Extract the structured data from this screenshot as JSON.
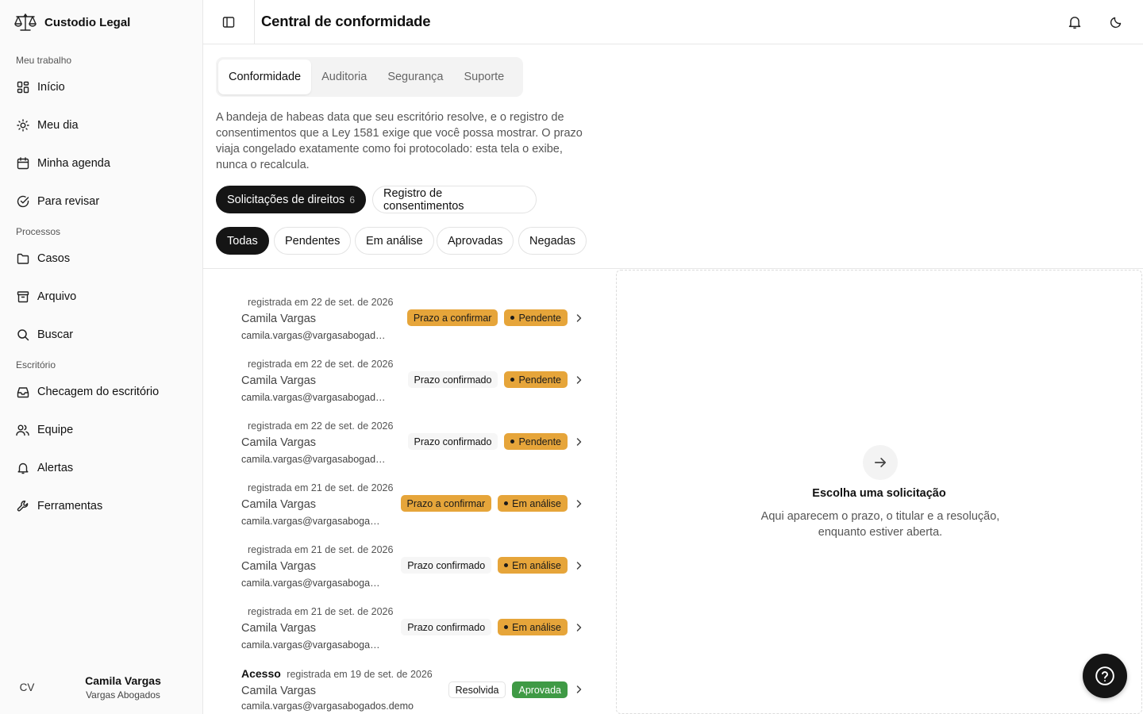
{
  "app": {
    "name": "Custodio Legal"
  },
  "sidebar": {
    "sections": [
      {
        "label": "Meu trabalho"
      },
      {
        "label": "Processos"
      },
      {
        "label": "Escritório"
      }
    ],
    "items": [
      {
        "label": "Início",
        "icon": "dashboard-icon"
      },
      {
        "label": "Meu dia",
        "icon": "sun-icon"
      },
      {
        "label": "Minha agenda",
        "icon": "calendar-icon"
      },
      {
        "label": "Para revisar",
        "icon": "check-circle-icon"
      },
      {
        "label": "Casos",
        "icon": "folder-icon"
      },
      {
        "label": "Arquivo",
        "icon": "archive-icon"
      },
      {
        "label": "Buscar",
        "icon": "search-icon"
      },
      {
        "label": "Checagem do escritório",
        "icon": "inbox-icon"
      },
      {
        "label": "Equipe",
        "icon": "users-icon"
      },
      {
        "label": "Alertas",
        "icon": "bell-icon"
      },
      {
        "label": "Ferramentas",
        "icon": "wrench-icon"
      }
    ],
    "user": {
      "initials": "CV",
      "name": "Camila Vargas",
      "org": "Vargas Abogados"
    }
  },
  "header": {
    "title": "Central de conformidade"
  },
  "tabs": [
    {
      "label": "Conformidade",
      "active": true
    },
    {
      "label": "Auditoria"
    },
    {
      "label": "Segurança"
    },
    {
      "label": "Suporte"
    }
  ],
  "intro": "A bandeja de habeas data que seu escritório resolve, e o registro de consentimentos que a Ley 1581 exige que você possa mostrar. O prazo viaja congelado exatamente como foi protocolado: esta tela o exibe, nunca o recalcula.",
  "view_toggle": {
    "requests_label": "Solicitações de direitos",
    "requests_count": "6",
    "consents_label": "Registro de consentimentos"
  },
  "filters": [
    "Todas",
    "Pendentes",
    "Em análise",
    "Aprovadas",
    "Negadas"
  ],
  "requests": [
    {
      "kind": "",
      "registered": "registrada em 22 de set. de 2026",
      "name": "Camila Vargas",
      "email": "camila.vargas@vargasabogados.demo",
      "deadline": "Prazo a confirmar",
      "status": "Pendente"
    },
    {
      "kind": "",
      "registered": "registrada em 22 de set. de 2026",
      "name": "Camila Vargas",
      "email": "camila.vargas@vargasabogados.demo",
      "deadline": "Prazo confirmado",
      "status": "Pendente"
    },
    {
      "kind": "",
      "registered": "registrada em 22 de set. de 2026",
      "name": "Camila Vargas",
      "email": "camila.vargas@vargasabogados.demo",
      "deadline": "Prazo confirmado",
      "status": "Pendente"
    },
    {
      "kind": "",
      "registered": "registrada em 21 de set. de 2026",
      "name": "Camila Vargas",
      "email": "camila.vargas@vargasabogados.demo",
      "deadline": "Prazo a confirmar",
      "status": "Em análise"
    },
    {
      "kind": "",
      "registered": "registrada em 21 de set. de 2026",
      "name": "Camila Vargas",
      "email": "camila.vargas@vargasabogados.demo",
      "deadline": "Prazo confirmado",
      "status": "Em análise"
    },
    {
      "kind": "",
      "registered": "registrada em 21 de set. de 2026",
      "name": "Camila Vargas",
      "email": "camila.vargas@vargasabogados.demo",
      "deadline": "Prazo confirmado",
      "status": "Em análise"
    },
    {
      "kind": "Acesso",
      "registered": "registrada em 19 de set. de 2026",
      "name": "Camila Vargas",
      "email": "camila.vargas@vargasabogados.demo",
      "deadline": "Resolvida",
      "status": "Aprovada"
    }
  ],
  "detail": {
    "empty_title": "Escolha uma solicitação",
    "empty_desc": "Aqui aparecem o prazo, o titular e a resolução, enquanto estiver aberta."
  },
  "colors": {
    "accent_orange": "#e6a53a",
    "success_green": "#3f9a45",
    "dark": "#151515"
  }
}
